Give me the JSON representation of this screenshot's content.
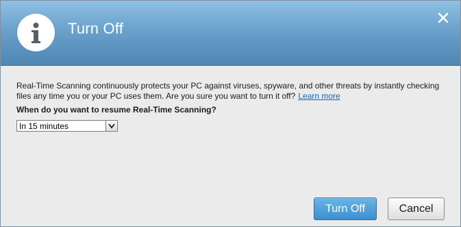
{
  "dialog": {
    "title": "Turn Off",
    "header_icon": "info-icon",
    "close_icon": "close-icon",
    "accent_color": "#4d86b3"
  },
  "content": {
    "description": "Real-Time Scanning continuously protects your PC against viruses, spyware, and other threats by instantly checking files any time you or your PC uses them. Are you sure you want to turn it off?",
    "learn_more_link": "Learn more",
    "question": "When do you want to resume Real-Time Scanning?",
    "resume_select": {
      "selected": "In 15 minutes"
    }
  },
  "buttons": {
    "turn_off_label": "Turn Off",
    "cancel_label": "Cancel"
  }
}
